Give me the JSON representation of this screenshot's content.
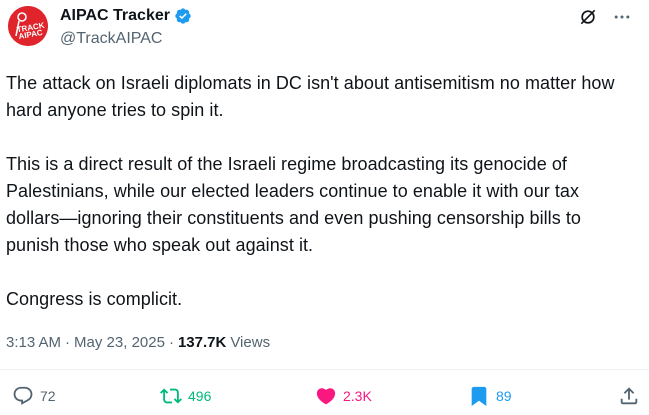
{
  "author": {
    "display_name": "AIPAC Tracker",
    "handle": "@TrackAIPAC",
    "avatar_text": "TRACK AIPAC"
  },
  "post": {
    "paragraphs": [
      "The attack on Israeli diplomats in DC isn't about antisemitism no matter how hard anyone tries to spin it.",
      "This is a direct result of the Israeli regime broadcasting its genocide of Palestinians, while our elected leaders continue to enable it with our tax dollars—ignoring their constituents and even pushing censorship bills to punish those who speak out against it.",
      "Congress is complicit."
    ],
    "time": "3:13 AM",
    "date": "May 23, 2025",
    "views_count": "137.7K",
    "views_label": "Views"
  },
  "actions": {
    "replies": "72",
    "reposts": "496",
    "likes": "2.3K",
    "bookmarks": "89"
  },
  "colors": {
    "text": "#0f1419",
    "muted": "#536471",
    "repost": "#00ba7c",
    "like": "#f91880",
    "bookmark": "#1d9bf0",
    "verified": "#1d9bf0",
    "avatar_bg": "#e0242b"
  },
  "icons": [
    "verified-badge-icon",
    "grok-icon",
    "more-icon",
    "reply-icon",
    "repost-icon",
    "like-icon",
    "bookmark-icon",
    "share-icon"
  ]
}
